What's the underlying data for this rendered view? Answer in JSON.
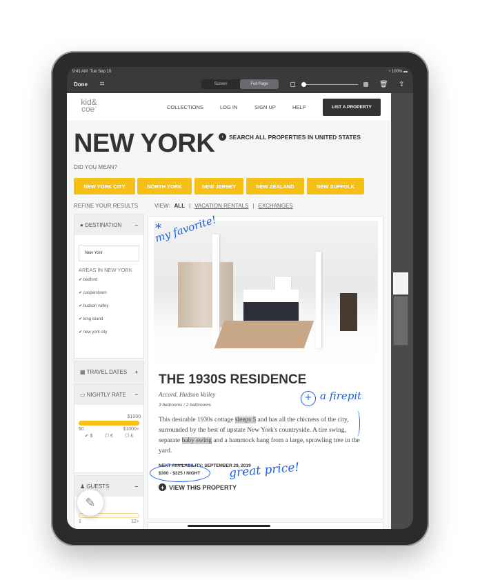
{
  "status": {
    "time": "9:41 AM",
    "date": "Tue Sep 10",
    "battery": "100%"
  },
  "toolbar": {
    "done": "Done",
    "modes": [
      "Screen",
      "Full Page"
    ],
    "selected_mode": "Full Page",
    "opacity_level": 0.05
  },
  "site": {
    "logo": "kid & coe",
    "nav": [
      "COLLECTIONS",
      "LOG IN",
      "SIGN UP",
      "HELP"
    ],
    "cta": "LIST A PROPERTY"
  },
  "header": {
    "title": "NEW YORK",
    "search_all": "SEARCH ALL PROPERTIES IN UNITED STATES",
    "did_you_mean": "DID YOU MEAN?",
    "suggestions": [
      "NEW YORK CITY",
      "NORTH YORK",
      "NEW JERSEY",
      "NEW ZEALAND",
      "NEW SUFFOLK"
    ]
  },
  "filters": {
    "refine": "REFINE YOUR RESULTS",
    "view_label": "VIEW:",
    "views": [
      "ALL",
      "VACATION RENTALS",
      "EXCHANGES"
    ],
    "selected_view": "ALL",
    "destination": {
      "label": "DESTINATION",
      "value": "New York",
      "areas_label": "AREAS IN NEW YORK",
      "areas": [
        "bedford",
        "cooperstown",
        "hudson valley",
        "long island",
        "new york city"
      ]
    },
    "travel_dates": "TRAVEL DATES",
    "nightly_rate": {
      "label": "NIGHTLY RATE",
      "max_value": "$1000",
      "min": "$0",
      "max": "$1000+",
      "currencies": [
        "$",
        "€",
        "£"
      ],
      "selected_currency": "$"
    },
    "guests": {
      "label": "GUESTS",
      "min": "1",
      "max": "12+"
    }
  },
  "listing": {
    "title": "THE 1930S RESIDENCE",
    "location": "Accord, Hudson Valley",
    "rooms": "3 bedrooms / 2 bathrooms",
    "desc_parts": [
      "This desirable 1930s cottage ",
      "sleeps 5",
      " and has all the chicness of the city, surrounded by the best of upstate New York's countryside. A tire swing, separate ",
      "baby swing",
      " and a hammock hang from a large, sprawling tree in the yard."
    ],
    "availability": "NEXT AVAILABILITY: SEPTEMBER 29, 2019",
    "price": "$300 - $325 / NIGHT",
    "view": "VIEW THIS PROPERTY"
  },
  "annotations": {
    "favorite": "my favorite!",
    "star": "*",
    "firepit": "a firepit",
    "plus": "+",
    "price": "great price!"
  }
}
